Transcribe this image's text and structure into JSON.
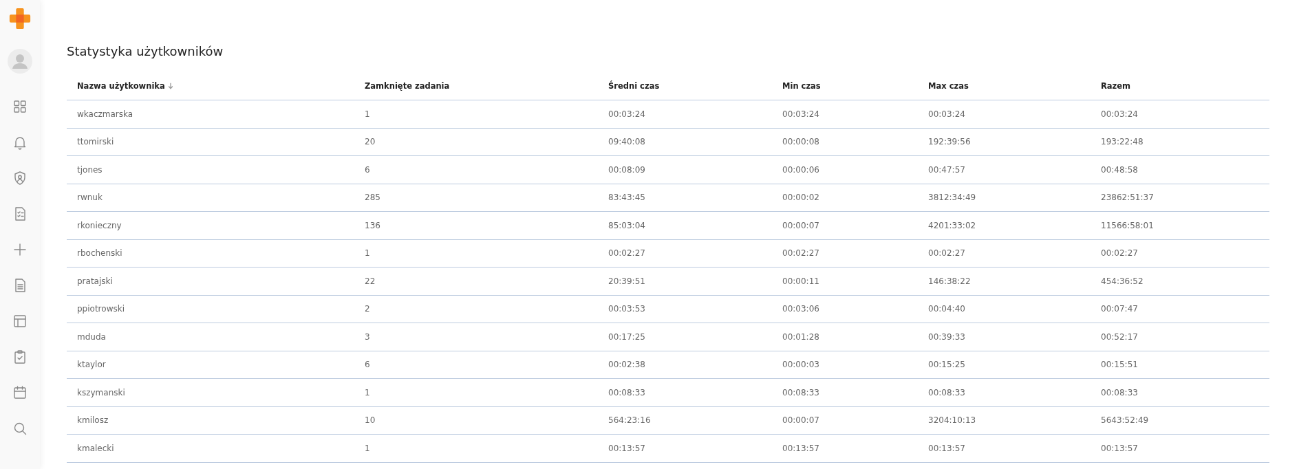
{
  "page": {
    "title": "Statystyka użytkowników"
  },
  "table": {
    "columns": [
      {
        "label": "Nazwa użytkownika",
        "sorted": true
      },
      {
        "label": "Zamknięte zadania",
        "sorted": false
      },
      {
        "label": "Średni czas",
        "sorted": false
      },
      {
        "label": "Min czas",
        "sorted": false
      },
      {
        "label": "Max czas",
        "sorted": false
      },
      {
        "label": "Razem",
        "sorted": false
      }
    ],
    "rows": [
      [
        "wkaczmarska",
        "1",
        "00:03:24",
        "00:03:24",
        "00:03:24",
        "00:03:24"
      ],
      [
        "ttomirski",
        "20",
        "09:40:08",
        "00:00:08",
        "192:39:56",
        "193:22:48"
      ],
      [
        "tjones",
        "6",
        "00:08:09",
        "00:00:06",
        "00:47:57",
        "00:48:58"
      ],
      [
        "rwnuk",
        "285",
        "83:43:45",
        "00:00:02",
        "3812:34:49",
        "23862:51:37"
      ],
      [
        "rkonieczny",
        "136",
        "85:03:04",
        "00:00:07",
        "4201:33:02",
        "11566:58:01"
      ],
      [
        "rbochenski",
        "1",
        "00:02:27",
        "00:02:27",
        "00:02:27",
        "00:02:27"
      ],
      [
        "pratajski",
        "22",
        "20:39:51",
        "00:00:11",
        "146:38:22",
        "454:36:52"
      ],
      [
        "ppiotrowski",
        "2",
        "00:03:53",
        "00:03:06",
        "00:04:40",
        "00:07:47"
      ],
      [
        "mduda",
        "3",
        "00:17:25",
        "00:01:28",
        "00:39:33",
        "00:52:17"
      ],
      [
        "ktaylor",
        "6",
        "00:02:38",
        "00:00:03",
        "00:15:25",
        "00:15:51"
      ],
      [
        "kszymanski",
        "1",
        "00:08:33",
        "00:08:33",
        "00:08:33",
        "00:08:33"
      ],
      [
        "kmilosz",
        "10",
        "564:23:16",
        "00:00:07",
        "3204:10:13",
        "5643:52:49"
      ],
      [
        "kmalecki",
        "1",
        "00:13:57",
        "00:13:57",
        "00:13:57",
        "00:13:57"
      ]
    ]
  }
}
